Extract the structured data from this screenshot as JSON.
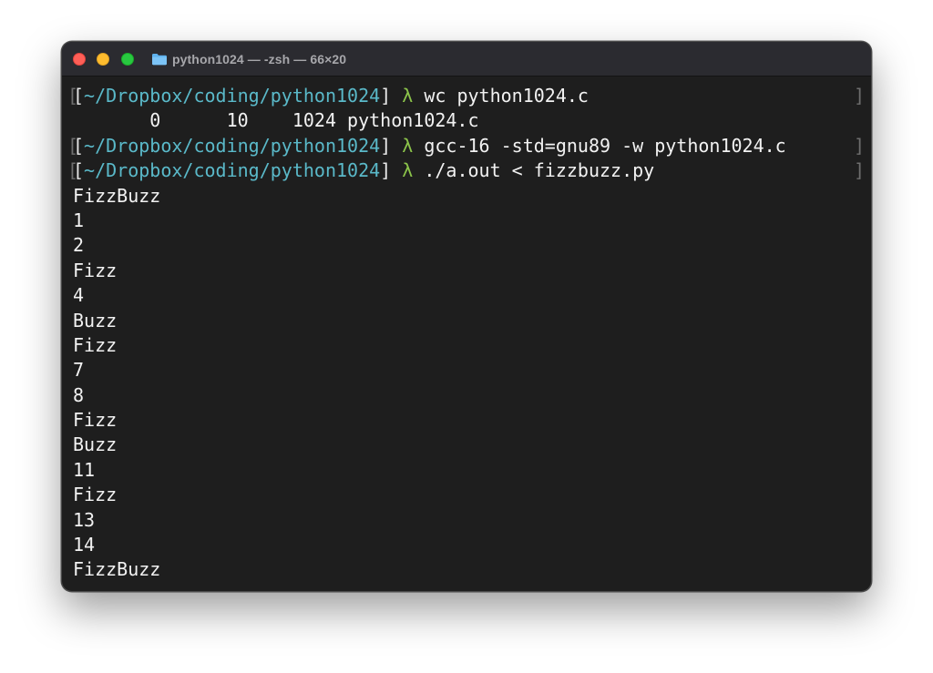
{
  "window": {
    "title": "python1024 — -zsh — 66×20"
  },
  "prompt": {
    "open_bracket": "[",
    "path": "~/Dropbox/coding/python1024",
    "close_bracket": "]",
    "symbol": "λ"
  },
  "terminal": {
    "lines": [
      {
        "kind": "command",
        "command": "wc python1024.c"
      },
      {
        "kind": "output",
        "text": "       0      10    1024 python1024.c"
      },
      {
        "kind": "command",
        "command": "gcc-16 -std=gnu89 -w python1024.c"
      },
      {
        "kind": "command",
        "command": "./a.out < fizzbuzz.py"
      },
      {
        "kind": "output",
        "text": "FizzBuzz"
      },
      {
        "kind": "output",
        "text": "1"
      },
      {
        "kind": "output",
        "text": "2"
      },
      {
        "kind": "output",
        "text": "Fizz"
      },
      {
        "kind": "output",
        "text": "4"
      },
      {
        "kind": "output",
        "text": "Buzz"
      },
      {
        "kind": "output",
        "text": "Fizz"
      },
      {
        "kind": "output",
        "text": "7"
      },
      {
        "kind": "output",
        "text": "8"
      },
      {
        "kind": "output",
        "text": "Fizz"
      },
      {
        "kind": "output",
        "text": "Buzz"
      },
      {
        "kind": "output",
        "text": "11"
      },
      {
        "kind": "output",
        "text": "Fizz"
      },
      {
        "kind": "output",
        "text": "13"
      },
      {
        "kind": "output",
        "text": "14"
      },
      {
        "kind": "output",
        "text": "FizzBuzz"
      }
    ]
  },
  "colors": {
    "background": "#1e1e1e",
    "path": "#5ab9c9",
    "lambda": "#8bc34a",
    "text": "#f2f2f2",
    "close": "#fe5f57",
    "minimize": "#febc2e",
    "maximize": "#28c840"
  },
  "icons": {
    "title": "folder-icon"
  }
}
